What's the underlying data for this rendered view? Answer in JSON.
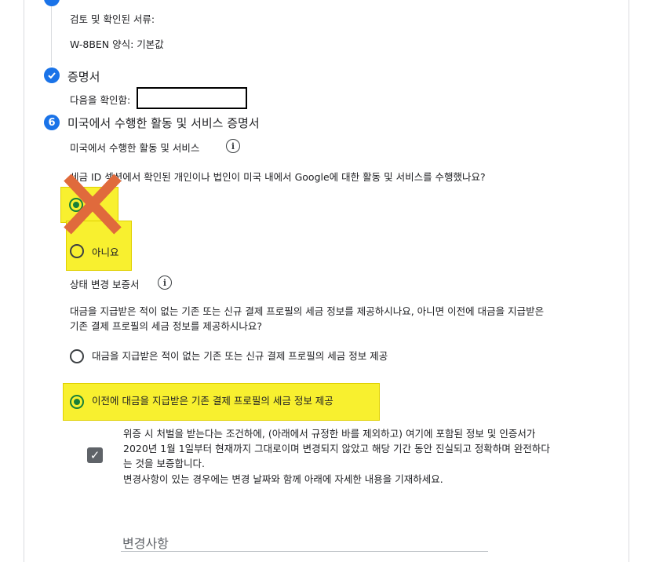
{
  "doc_review": {
    "heading": "검토 및 확인된 서류:",
    "form_value": "W-8BEN 양식: 기본값"
  },
  "certification": {
    "title": "증명서",
    "confirm_label": "다음을 확인함:"
  },
  "us_activities": {
    "step_number": "6",
    "title": "미국에서 수행한 활동 및 서비스 증명서",
    "subheading": "미국에서 수행한 활동 및 서비스",
    "question": "세금 ID 섹션에서 확인된 개인이나 법인이 미국 내에서 Google에 대한 활동 및 서비스를 수행했나요?",
    "option_yes": "",
    "option_no": "아니요",
    "selected": "yes"
  },
  "status_change": {
    "heading": "상태 변경 보증서",
    "question_line1": "대금을 지급받은 적이 없는 기존 또는 신규 결제 프로필의 세금 정보를 제공하시나요, 아니면 이전에 대금을 지급받은",
    "question_line2": "기존 결제 프로필의 세금 정보를 제공하시나요?",
    "option_new": "대금을 지급받은 적이 없는 기존 또는 신규 결제 프로필의 세금 정보 제공",
    "option_previous": "이전에 대금을 지급받은 기존 결제 프로필의 세금 정보 제공",
    "selected": "previous"
  },
  "attestation": {
    "line1": "위증 시 처벌을 받는다는 조건하에, (아래에서 규정한 바를 제외하고) 여기에 포함된 정보 및 인증서가",
    "line2": "2020년 1월 1일부터 현재까지 그대로이며 변경되지 않았고 해당 기간 동안 진실되고 정확하며 완전하다",
    "line3": "는 것을 보증합니다.",
    "line4": "변경사항이 있는 경우에는 변경 날짜와 함께 아래에 자세한 내용을 기재하세요.",
    "checked": true
  },
  "changes_field": {
    "label": "변경사항"
  },
  "colors": {
    "accent": "#1a73e8",
    "radio_checked": "#188038",
    "highlight": "#f8f02f",
    "x_mark": "#e06a3c"
  }
}
